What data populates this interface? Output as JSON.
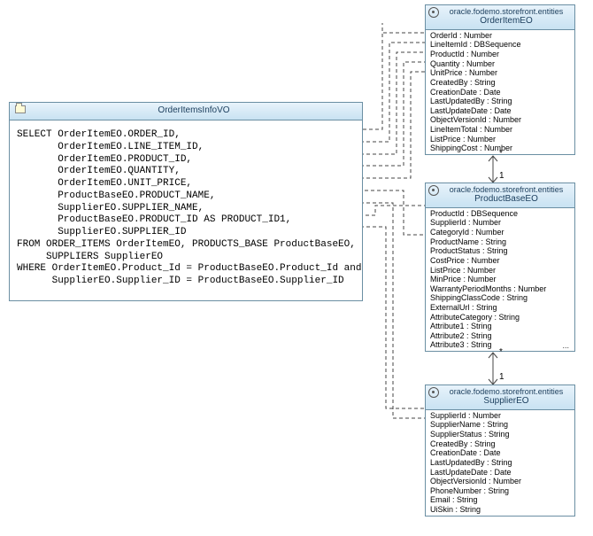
{
  "viewObject": {
    "title": "OrderItemsInfoVO",
    "sql": "SELECT OrderItemEO.ORDER_ID,\n       OrderItemEO.LINE_ITEM_ID,\n       OrderItemEO.PRODUCT_ID,\n       OrderItemEO.QUANTITY,\n       OrderItemEO.UNIT_PRICE,\n       ProductBaseEO.PRODUCT_NAME,\n       SupplierEO.SUPPLIER_NAME,\n       ProductBaseEO.PRODUCT_ID AS PRODUCT_ID1,\n       SupplierEO.SUPPLIER_ID\nFROM ORDER_ITEMS OrderItemEO, PRODUCTS_BASE ProductBaseEO,\n     SUPPLIERS SupplierEO\nWHERE OrderItemEO.Product_Id = ProductBaseEO.Product_Id and\n      SupplierEO.Supplier_ID = ProductBaseEO.Supplier_ID"
  },
  "entities": {
    "orderItem": {
      "pkg": "oracle.fodemo.storefront.entities",
      "name": "OrderItemEO",
      "attrs": [
        "OrderId : Number",
        "LineItemId : DBSequence",
        "ProductId : Number",
        "Quantity : Number",
        "UnitPrice : Number",
        "CreatedBy : String",
        "CreationDate : Date",
        "LastUpdatedBy : String",
        "LastUpdateDate : Date",
        "ObjectVersionId : Number",
        "LineItemTotal : Number",
        "ListPrice : Number",
        "ShippingCost : Number"
      ]
    },
    "productBase": {
      "pkg": "oracle.fodemo.storefront.entities",
      "name": "ProductBaseEO",
      "attrs": [
        "ProductId : DBSequence",
        "SupplierId : Number",
        "CategoryId : Number",
        "ProductName : String",
        "ProductStatus : String",
        "CostPrice : Number",
        "ListPrice : Number",
        "MinPrice : Number",
        "WarrantyPeriodMonths : Number",
        "ShippingClassCode : String",
        "ExternalUrl : String",
        "AttributeCategory : String",
        "Attribute1 : String",
        "Attribute2 : String",
        "Attribute3 : String"
      ]
    },
    "supplier": {
      "pkg": "oracle.fodemo.storefront.entities",
      "name": "SupplierEO",
      "attrs": [
        "SupplierId : Number",
        "SupplierName : String",
        "SupplierStatus : String",
        "CreatedBy : String",
        "CreationDate : Date",
        "LastUpdatedBy : String",
        "LastUpdateDate : Date",
        "ObjectVersionId : Number",
        "PhoneNumber : String",
        "Email : String",
        "UiSkin : String"
      ]
    }
  },
  "multiplicities": {
    "orderItemToProduct_top": "*",
    "orderItemToProduct_bottom": "1",
    "productToSupplier_top": "*",
    "productToSupplier_bottom": "1"
  }
}
